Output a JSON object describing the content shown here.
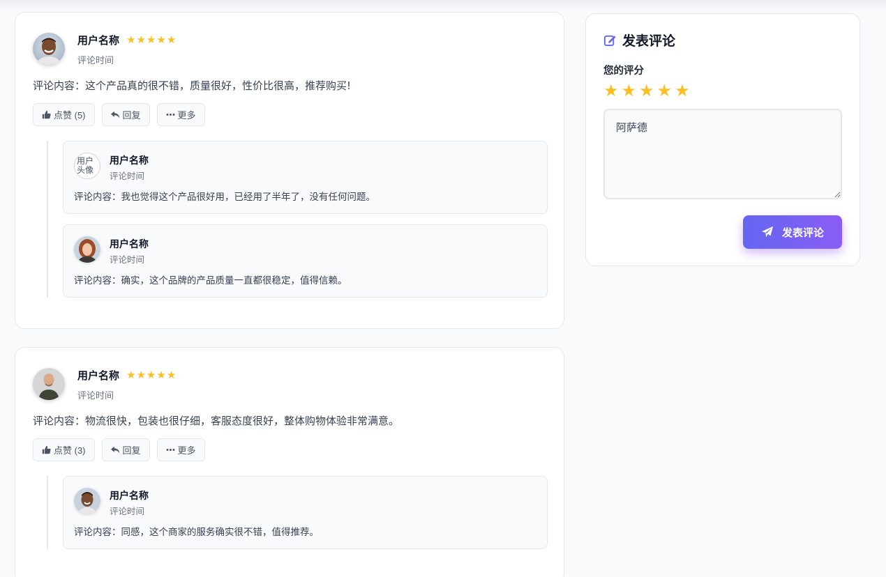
{
  "comments": [
    {
      "name": "用户名称",
      "time": "评论时间",
      "stars": 5,
      "content": "评论内容：这个产品真的很不错，质量很好，性价比很高，推荐购买!",
      "like_label": "点赞 (5)",
      "reply_label": "回复",
      "more_label": "更多",
      "replies": [
        {
          "name": "用户名称",
          "time": "评论时间",
          "content": "评论内容：我也觉得这个产品很好用，已经用了半年了，没有任何问题。",
          "avatar_alt": "用户头像"
        },
        {
          "name": "用户名称",
          "time": "评论时间",
          "content": "评论内容：确实，这个品牌的产品质量一直都很稳定，值得信赖。"
        }
      ]
    },
    {
      "name": "用户名称",
      "time": "评论时间",
      "stars": 5,
      "content": "评论内容：物流很快，包装也很仔细，客服态度很好，整体购物体验非常满意。",
      "like_label": "点赞 (3)",
      "reply_label": "回复",
      "more_label": "更多",
      "replies": [
        {
          "name": "用户名称",
          "time": "评论时间",
          "content": "评论内容：同感，这个商家的服务确实很不错，值得推荐。"
        }
      ]
    }
  ],
  "form": {
    "title": "发表评论",
    "rating_label": "您的评分",
    "rating": 5,
    "textarea_value": "阿萨德",
    "submit_label": "发表评论"
  },
  "colors": {
    "star": "#fbbf24",
    "accent_start": "#6366f1",
    "accent_end": "#8b5cf6"
  },
  "icons": [
    "thumbs-up-icon",
    "reply-icon",
    "ellipsis-icon",
    "edit-icon",
    "paper-plane-icon",
    "star-icon"
  ]
}
